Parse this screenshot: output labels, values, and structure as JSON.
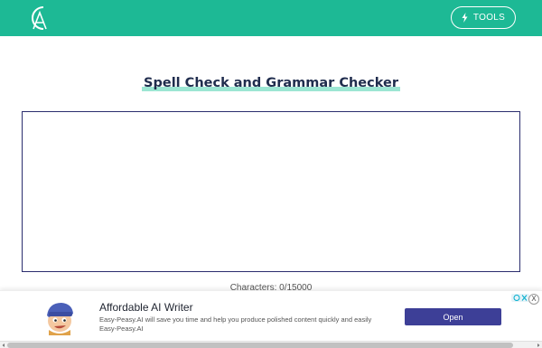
{
  "header": {
    "logo_icon": "ca-monogram-logo",
    "tools_label": "TOOLS",
    "tools_icon": "lightning-bolt-icon",
    "background_color": "#1db995"
  },
  "main": {
    "title": "Spell Check and Grammar Checker",
    "editor_value": "",
    "char_count": "Characters: 0/15000"
  },
  "ad": {
    "title": "Affordable AI Writer",
    "description": "Easy-Peasy.AI will save you time and help you produce polished content quickly and easily",
    "advertiser": "Easy-Peasy.AI",
    "cta_label": "Open",
    "close_label": "X",
    "button_color": "#3d3f97"
  }
}
